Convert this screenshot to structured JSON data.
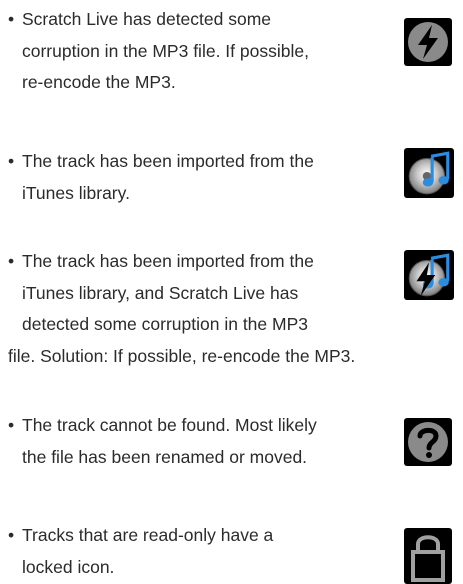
{
  "items": [
    {
      "icon": "corrupt-icon",
      "lines": [
        "Scratch Live has detected some",
        "corruption in the MP3 file. If possible,",
        "re-encode the MP3."
      ]
    },
    {
      "icon": "itunes-icon",
      "lines": [
        "The track has been imported from the",
        "iTunes library."
      ]
    },
    {
      "icon": "itunes-corrupt-icon",
      "lines": [
        "The track has been imported from the",
        "iTunes library, and Scratch Live has",
        "detected some corruption in the MP3",
        "file. Solution: If possible, re-encode the MP3."
      ]
    },
    {
      "icon": "question-icon",
      "lines": [
        "The track cannot be found. Most likely",
        "the file has been renamed or moved."
      ]
    },
    {
      "icon": "lock-icon",
      "lines": [
        "Tracks that are read-only have a",
        "locked icon."
      ]
    }
  ],
  "bullet": "•"
}
